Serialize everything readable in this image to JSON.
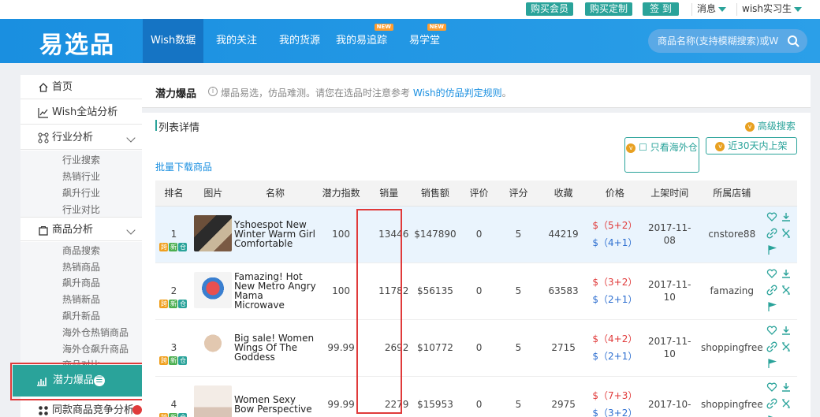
{
  "topbar": {
    "buy_member": "购买会员",
    "buy_custom": "购买定制",
    "checkin": "签 到",
    "messages": "消息",
    "user": "wish实习生"
  },
  "header": {
    "logo": "易选品",
    "nav": [
      {
        "label": "Wish数据",
        "active": true,
        "new": false
      },
      {
        "label": "我的关注",
        "active": false,
        "new": false
      },
      {
        "label": "我的货源",
        "active": false,
        "new": false
      },
      {
        "label": "我的易追踪",
        "active": false,
        "new": true
      },
      {
        "label": "易学堂",
        "active": false,
        "new": true
      }
    ],
    "new_tag": "NEW",
    "search_placeholder": "商品名称(支持模糊搜索)或W"
  },
  "sidebar": {
    "home": "首页",
    "site_analysis": "Wish全站分析",
    "industry": "行业分析",
    "industry_items": [
      "行业搜索",
      "热销行业",
      "飙升行业",
      "行业对比"
    ],
    "product": "商品分析",
    "product_items": [
      "商品搜索",
      "热销商品",
      "飙升商品",
      "热销新品",
      "飙升新品",
      "海外仓热销商品",
      "海外仓飙升商品",
      "商品对比"
    ],
    "potential": "潜力爆品",
    "competition": "同款商品竞争分析"
  },
  "main": {
    "title": "潜力爆品",
    "subtitle": "爆品易选，仿品难测。请您在选品时注意参考",
    "rule_link": "Wish的仿品判定规则",
    "rule_suffix": "。",
    "list_title": "列表详情",
    "advanced_search": "高级搜索",
    "overseas_only": "只看海外仓",
    "recent_30": "近30天内上架",
    "batch_download": "批量下载商品"
  },
  "table": {
    "headers": [
      "排名",
      "图片",
      "名称",
      "潜力指数",
      "销量",
      "销售额",
      "评价",
      "评分",
      "收藏",
      "价格",
      "上架时间",
      "所属店铺"
    ],
    "rows": [
      {
        "rank": "1",
        "name": "Yshoespot New Winter Warm Girl Comfortable",
        "potential": "100",
        "sales": "13446",
        "revenue": "$147890",
        "reviews": "0",
        "rating": "5",
        "favorites": "44219",
        "price_r": "$（5+2）",
        "price_b": "$（4+1）",
        "date": "2017-11-08",
        "store": "cnstore88"
      },
      {
        "rank": "2",
        "name": "Famazing! Hot New Metro Angry Mama Microwave",
        "potential": "100",
        "sales": "11782",
        "revenue": "$56135",
        "reviews": "0",
        "rating": "5",
        "favorites": "63583",
        "price_r": "$（3+2）",
        "price_b": "$（2+1）",
        "date": "2017-11-10",
        "store": "famazing"
      },
      {
        "rank": "3",
        "name": "Big sale! Women Wings Of The Goddess",
        "potential": "99.99",
        "sales": "2692",
        "revenue": "$10772",
        "reviews": "0",
        "rating": "5",
        "favorites": "2715",
        "price_r": "$（4+2）",
        "price_b": "$（2+1）",
        "date": "2017-11-10",
        "store": "shoppingfree"
      },
      {
        "rank": "4",
        "name": "Women Sexy Bow Perspective",
        "potential": "99.99",
        "sales": "2279",
        "revenue": "$15953",
        "reviews": "0",
        "rating": "5",
        "favorites": "2975",
        "price_r": "$（7+3）",
        "price_b": "$（3+2）",
        "date": "2017-10-",
        "store": "shoppingfree"
      }
    ],
    "platform_tags": [
      "跨",
      "新",
      "仓"
    ]
  },
  "colors": {
    "brand": "#1a8fe0",
    "accent": "#2aa39a",
    "highlight_box": "#e03a3a"
  }
}
